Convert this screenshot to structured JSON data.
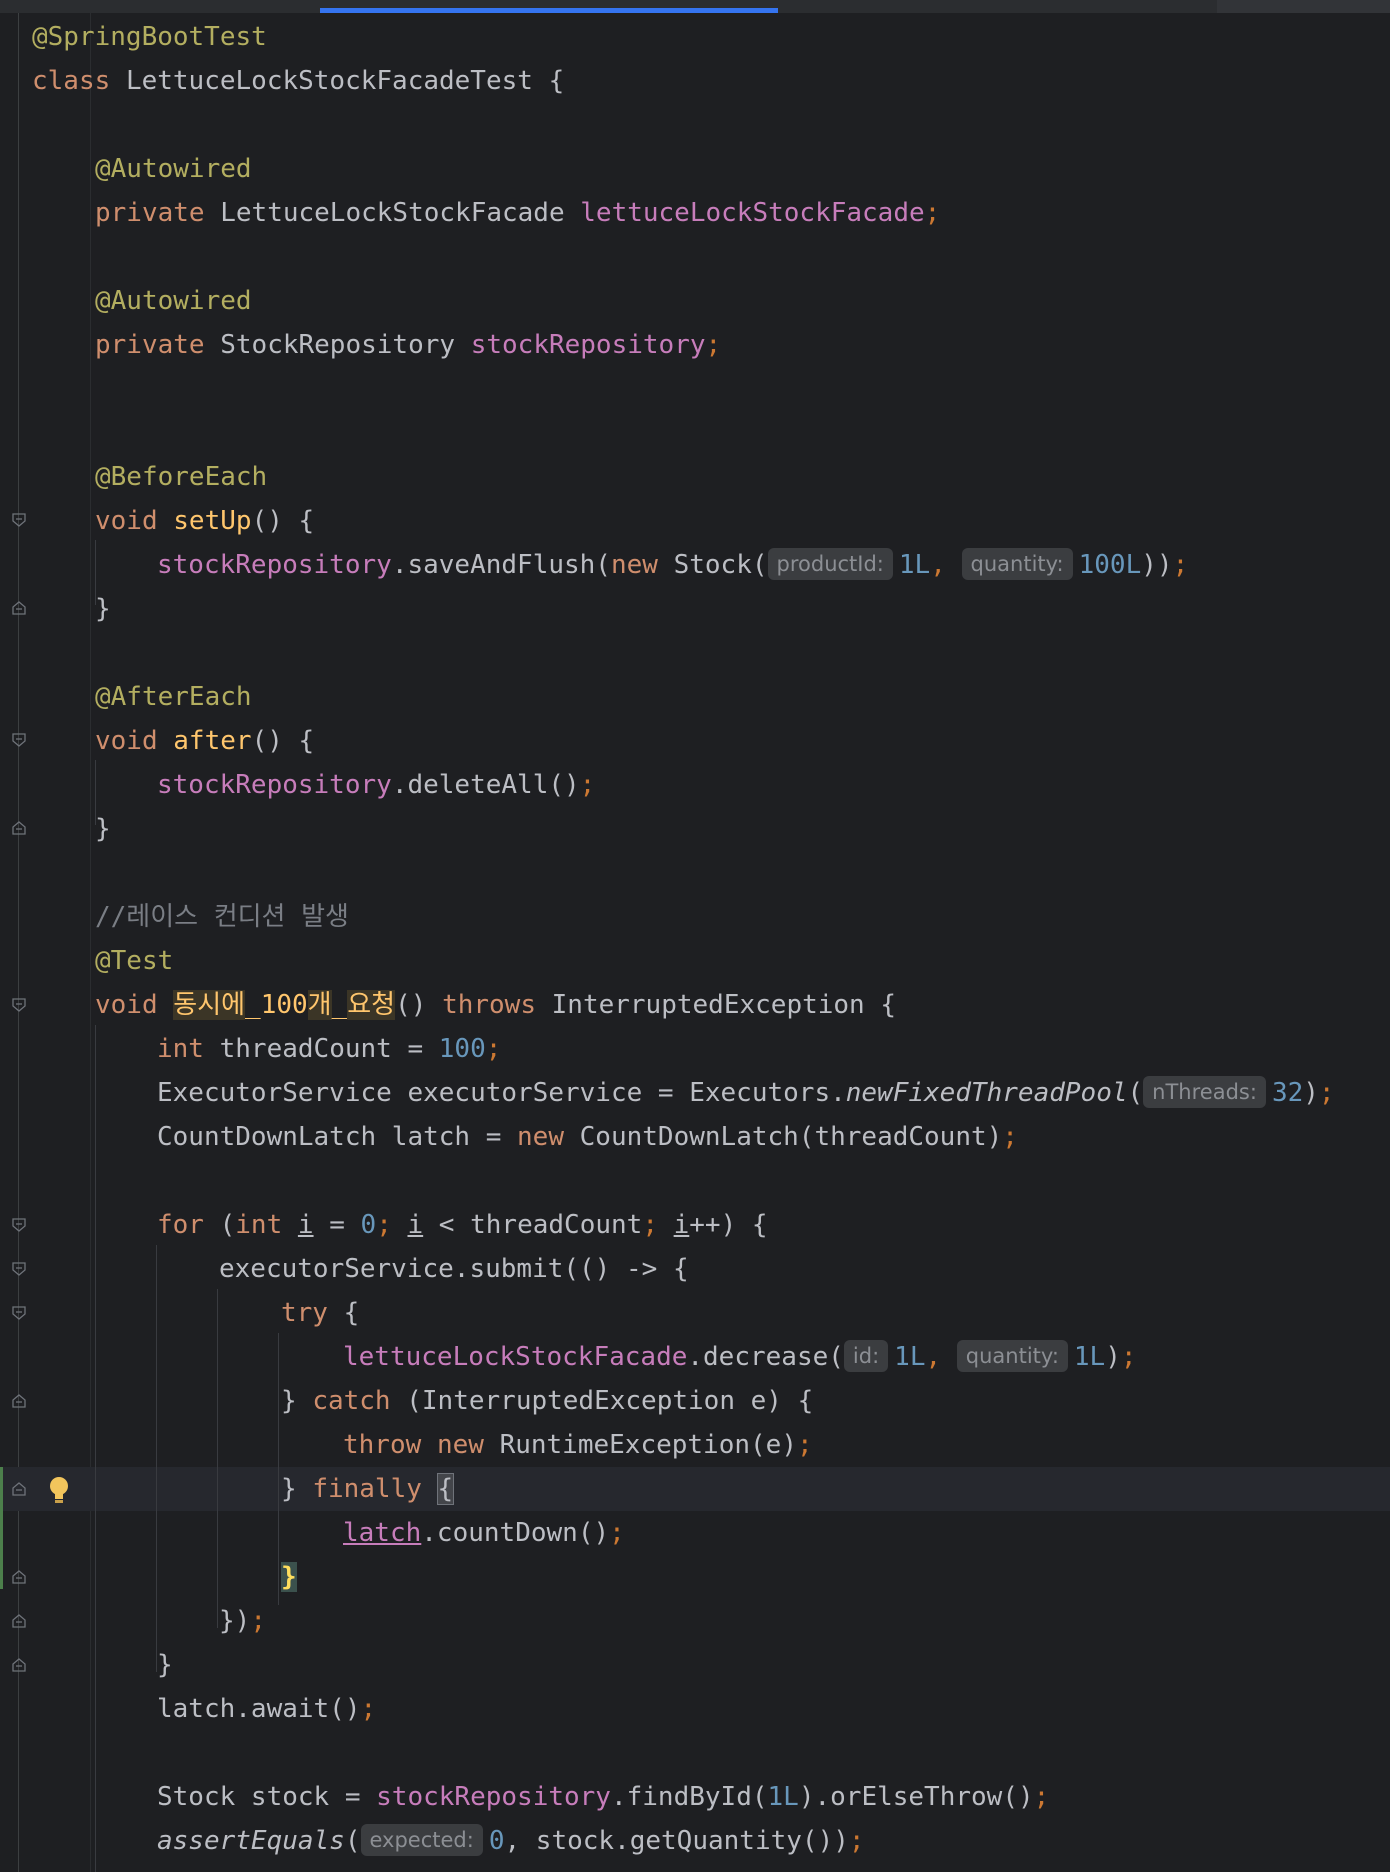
{
  "editor": {
    "lines": {
      "l1": [
        "@SpringBootTest"
      ],
      "l2": [
        "class",
        "LettuceLockStockFacadeTest {"
      ],
      "l4": [
        "@Autowired"
      ],
      "l5": [
        "private",
        "LettuceLockStockFacade",
        "lettuceLockStockFacade",
        ";"
      ],
      "l7": [
        "@Autowired"
      ],
      "l8": [
        "private",
        "StockRepository",
        "stockRepository",
        ";"
      ],
      "l11": [
        "@BeforeEach"
      ],
      "l12": [
        "void",
        "setUp",
        "() {"
      ],
      "l13": [
        "stockRepository",
        ".saveAndFlush(",
        "new",
        "Stock(",
        "productId:",
        "1L",
        ",",
        "quantity:",
        "100L",
        "))",
        ";"
      ],
      "l14": [
        "}"
      ],
      "l16": [
        "@AfterEach"
      ],
      "l17": [
        "void",
        "after",
        "() {"
      ],
      "l18": [
        "stockRepository",
        ".deleteAll()",
        ";"
      ],
      "l19": [
        "}"
      ],
      "l21": [
        "//레이스 컨디션 발생"
      ],
      "l22": [
        "@Test"
      ],
      "l23": [
        "void",
        "동시에",
        "_100",
        "개",
        "_",
        "요청",
        "()",
        "throws",
        "InterruptedException {"
      ],
      "l24": [
        "int",
        "threadCount = ",
        "100",
        ";"
      ],
      "l25": [
        "ExecutorService executorService = Executors.",
        "newFixedThreadPool",
        "(",
        "nThreads:",
        "32",
        ")",
        ";"
      ],
      "l26": [
        "CountDownLatch latch = ",
        "new",
        "CountDownLatch(threadCount)",
        ";"
      ],
      "l28": [
        "for",
        "(",
        "int",
        "i",
        " = ",
        "0",
        ";",
        "i",
        " < threadCount",
        ";",
        "i",
        "++) {"
      ],
      "l29": [
        "executorService.submit(() -> {"
      ],
      "l30": [
        "try",
        "{"
      ],
      "l31": [
        "lettuceLockStockFacade",
        ".decrease(",
        "id:",
        "1L",
        ",",
        "quantity:",
        "1L",
        ")",
        ";"
      ],
      "l32": [
        "} ",
        "catch",
        "(InterruptedException e) {"
      ],
      "l33": [
        "throw",
        "new",
        "RuntimeException(e)",
        ";"
      ],
      "l34": [
        "} ",
        "finally",
        "{"
      ],
      "l35": [
        "latch",
        ".countDown()",
        ";"
      ],
      "l36": [
        "}"
      ],
      "l37": [
        "})",
        ";"
      ],
      "l38": [
        "}"
      ],
      "l39": [
        "latch.await()",
        ";"
      ],
      "l41": [
        "Stock stock = ",
        "stockRepository",
        ".findById(",
        "1L",
        ").orElseThrow()",
        ";"
      ],
      "l42": [
        "assertEquals",
        "(",
        "expected:",
        "0",
        ", stock.getQuantity())",
        ";"
      ]
    }
  },
  "colors": {
    "background": "#1e1f22",
    "keyword": "#cf8e6d",
    "annotation": "#b3ae60",
    "field": "#c77dbb",
    "number": "#6897bb",
    "method_decl": "#ffc66d",
    "comment": "#7a7e85",
    "tab_indicator": "#3574f0"
  },
  "icons": {
    "intention_bulb": "lightbulb-icon",
    "fold_marker": "fold-icon"
  }
}
